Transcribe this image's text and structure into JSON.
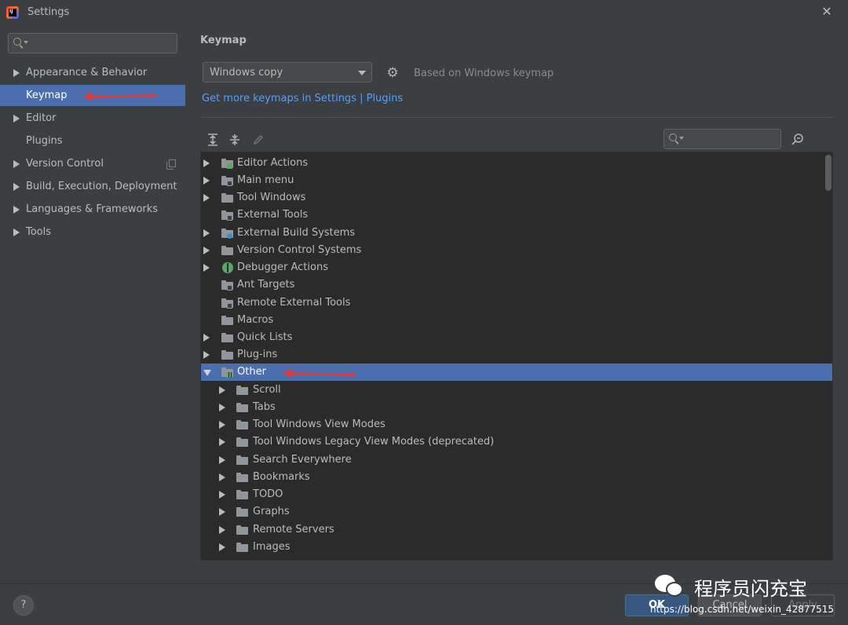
{
  "window": {
    "title": "Settings",
    "close": "✕"
  },
  "sidebar": {
    "search_placeholder": "",
    "items": [
      {
        "label": "Appearance & Behavior"
      },
      {
        "label": "Keymap"
      },
      {
        "label": "Editor"
      },
      {
        "label": "Plugins"
      },
      {
        "label": "Version Control"
      },
      {
        "label": "Build, Execution, Deployment"
      },
      {
        "label": "Languages & Frameworks"
      },
      {
        "label": "Tools"
      }
    ]
  },
  "keymap": {
    "heading": "Keymap",
    "selected": "Windows copy",
    "based_on": "Based on Windows keymap",
    "more_link": "Get more keymaps in Settings | Plugins"
  },
  "tree": {
    "items": [
      {
        "label": "Editor Actions"
      },
      {
        "label": "Main menu"
      },
      {
        "label": "Tool Windows"
      },
      {
        "label": "External Tools"
      },
      {
        "label": "External Build Systems"
      },
      {
        "label": "Version Control Systems"
      },
      {
        "label": "Debugger Actions"
      },
      {
        "label": "Ant Targets"
      },
      {
        "label": "Remote External Tools"
      },
      {
        "label": "Macros"
      },
      {
        "label": "Quick Lists"
      },
      {
        "label": "Plug-ins"
      },
      {
        "label": "Other"
      }
    ],
    "children": [
      {
        "label": "Scroll"
      },
      {
        "label": "Tabs"
      },
      {
        "label": "Tool Windows View Modes"
      },
      {
        "label": "Tool Windows Legacy View Modes (deprecated)"
      },
      {
        "label": "Search Everywhere"
      },
      {
        "label": "Bookmarks"
      },
      {
        "label": "TODO"
      },
      {
        "label": "Graphs"
      },
      {
        "label": "Remote Servers"
      },
      {
        "label": "Images"
      }
    ]
  },
  "footer": {
    "help": "?",
    "ok": "OK",
    "cancel": "Cancel",
    "apply": "Apply"
  },
  "watermark": {
    "name": "程序员闪充宝",
    "url": "https://blog.csdn.net/weixin_42877515"
  },
  "colors": {
    "selection": "#4b6eaf",
    "link": "#589df6",
    "annotation": "#e53935"
  }
}
